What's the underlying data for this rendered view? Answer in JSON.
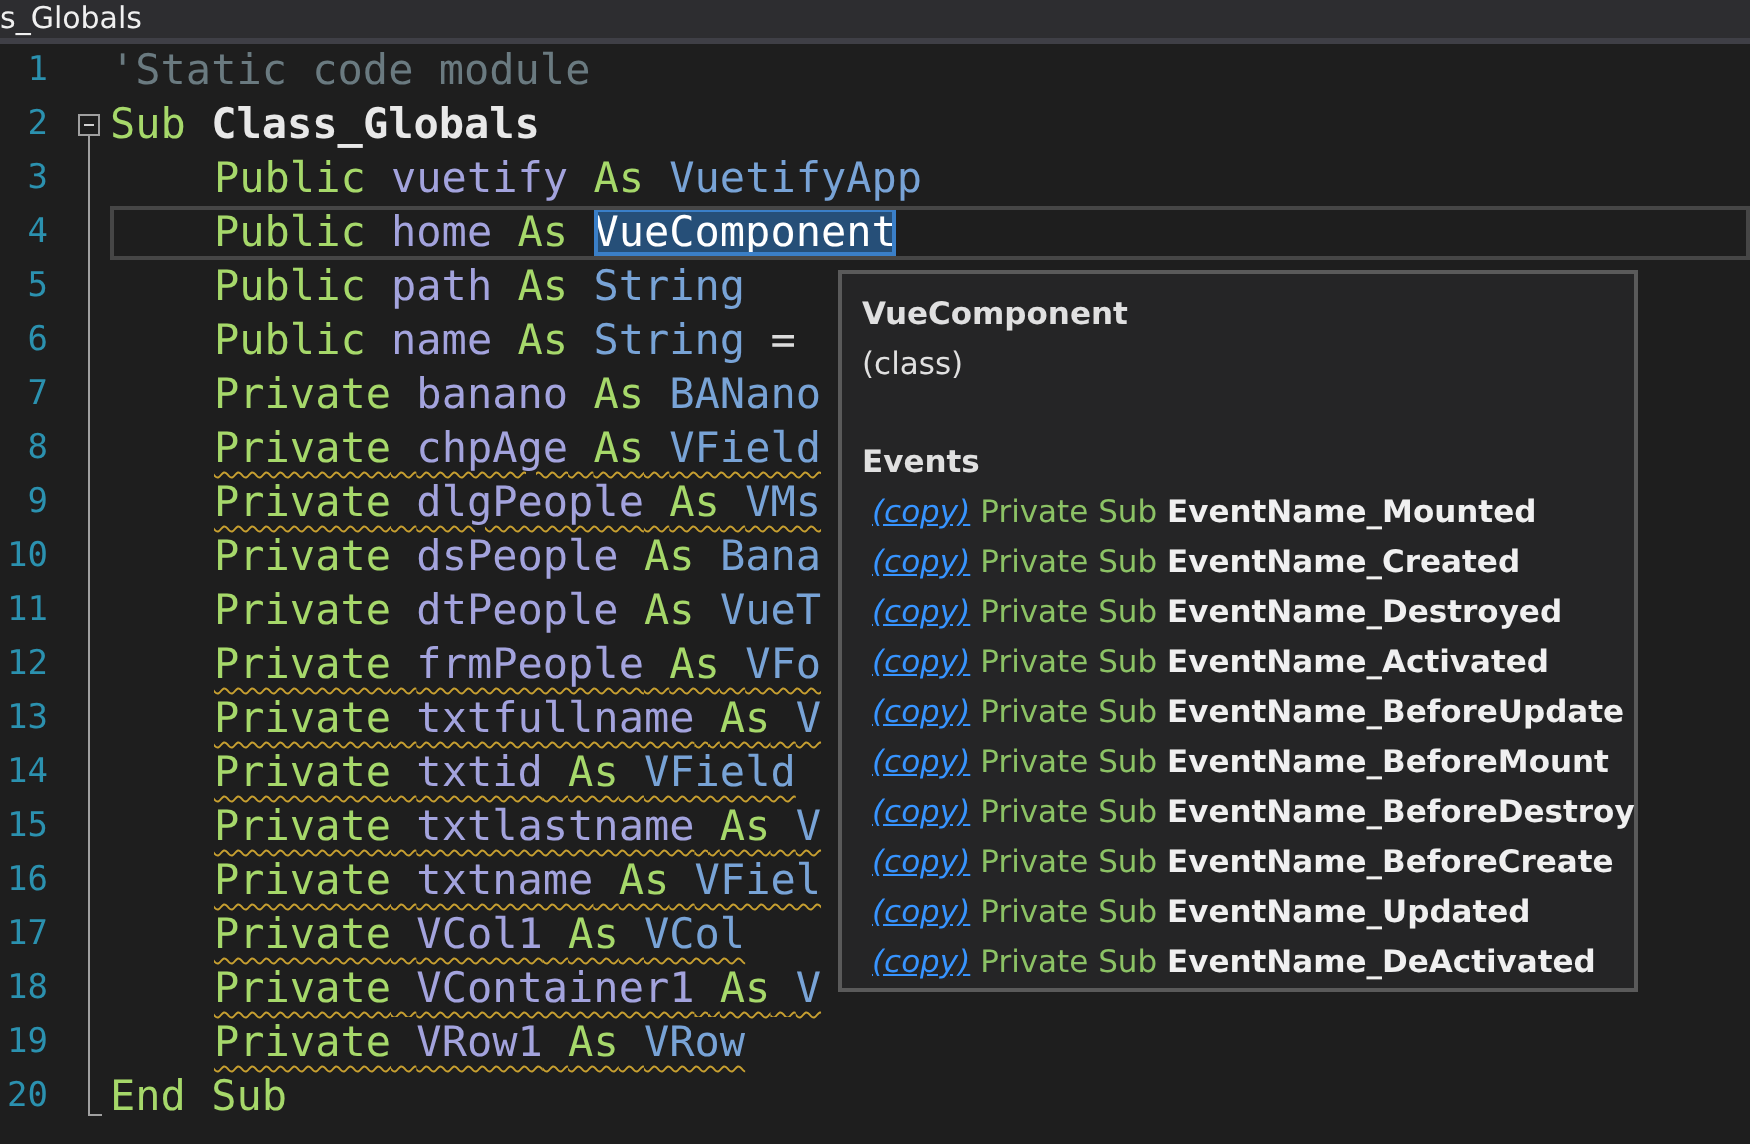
{
  "tab": {
    "title": "s_Globals"
  },
  "lines": [
    {
      "number": "1",
      "current": false,
      "warning": false,
      "tokens": [
        {
          "kind": "comment",
          "text": "'Static code module"
        }
      ]
    },
    {
      "number": "2",
      "current": false,
      "warning": false,
      "expanded": true,
      "tokens": [
        {
          "kind": "keyword",
          "text": "Sub"
        },
        {
          "kind": "name",
          "text": "Class_Globals"
        }
      ],
      "children": [
        {
          "number": "3",
          "current": false,
          "warning": false,
          "tokens": [
            {
              "kind": "keyword",
              "text": "Public"
            },
            {
              "kind": "ident",
              "text": "vuetify"
            },
            {
              "kind": "keyword",
              "text": "As"
            },
            {
              "kind": "type",
              "text": "VuetifyApp"
            }
          ]
        },
        {
          "number": "4",
          "current": true,
          "warning": false,
          "tokens": [
            {
              "kind": "keyword",
              "text": "Public"
            },
            {
              "kind": "ident",
              "text": "home"
            },
            {
              "kind": "keyword",
              "text": "As"
            },
            {
              "kind": "selected",
              "text": "VueComponent"
            }
          ]
        },
        {
          "number": "5",
          "current": false,
          "warning": false,
          "tokens": [
            {
              "kind": "keyword",
              "text": "Public"
            },
            {
              "kind": "ident",
              "text": "path"
            },
            {
              "kind": "keyword",
              "text": "As"
            },
            {
              "kind": "type",
              "text": "String"
            }
          ]
        },
        {
          "number": "6",
          "current": false,
          "warning": false,
          "tokens": [
            {
              "kind": "keyword",
              "text": "Public"
            },
            {
              "kind": "ident",
              "text": "name"
            },
            {
              "kind": "keyword",
              "text": "As"
            },
            {
              "kind": "type",
              "text": "String"
            },
            {
              "kind": "plain",
              "text": "="
            }
          ]
        },
        {
          "number": "7",
          "current": false,
          "warning": false,
          "tokens": [
            {
              "kind": "keyword",
              "text": "Private"
            },
            {
              "kind": "ident",
              "text": "banano"
            },
            {
              "kind": "keyword",
              "text": "As"
            },
            {
              "kind": "type",
              "text": "BANano"
            }
          ]
        },
        {
          "number": "8",
          "current": false,
          "warning": true,
          "tokens": [
            {
              "kind": "keyword",
              "text": "Private"
            },
            {
              "kind": "ident",
              "text": "chpAge"
            },
            {
              "kind": "keyword",
              "text": "As"
            },
            {
              "kind": "type",
              "text": "VField"
            }
          ]
        },
        {
          "number": "9",
          "current": false,
          "warning": true,
          "tokens": [
            {
              "kind": "keyword",
              "text": "Private"
            },
            {
              "kind": "ident",
              "text": "dlgPeople"
            },
            {
              "kind": "keyword",
              "text": "As"
            },
            {
              "kind": "type",
              "text": "VMs"
            }
          ]
        },
        {
          "number": "10",
          "current": false,
          "warning": false,
          "tokens": [
            {
              "kind": "keyword",
              "text": "Private"
            },
            {
              "kind": "ident",
              "text": "dsPeople"
            },
            {
              "kind": "keyword",
              "text": "As"
            },
            {
              "kind": "type",
              "text": "Bana"
            }
          ]
        },
        {
          "number": "11",
          "current": false,
          "warning": false,
          "tokens": [
            {
              "kind": "keyword",
              "text": "Private"
            },
            {
              "kind": "ident",
              "text": "dtPeople"
            },
            {
              "kind": "keyword",
              "text": "As"
            },
            {
              "kind": "type",
              "text": "VueT"
            }
          ]
        },
        {
          "number": "12",
          "current": false,
          "warning": true,
          "tokens": [
            {
              "kind": "keyword",
              "text": "Private"
            },
            {
              "kind": "ident",
              "text": "frmPeople"
            },
            {
              "kind": "keyword",
              "text": "As"
            },
            {
              "kind": "type",
              "text": "VFo"
            }
          ]
        },
        {
          "number": "13",
          "current": false,
          "warning": true,
          "tokens": [
            {
              "kind": "keyword",
              "text": "Private"
            },
            {
              "kind": "ident",
              "text": "txtfullname"
            },
            {
              "kind": "keyword",
              "text": "As"
            },
            {
              "kind": "type",
              "text": "V"
            }
          ]
        },
        {
          "number": "14",
          "current": false,
          "warning": true,
          "tokens": [
            {
              "kind": "keyword",
              "text": "Private"
            },
            {
              "kind": "ident",
              "text": "txtid"
            },
            {
              "kind": "keyword",
              "text": "As"
            },
            {
              "kind": "type",
              "text": "VField"
            }
          ]
        },
        {
          "number": "15",
          "current": false,
          "warning": true,
          "tokens": [
            {
              "kind": "keyword",
              "text": "Private"
            },
            {
              "kind": "ident",
              "text": "txtlastname"
            },
            {
              "kind": "keyword",
              "text": "As"
            },
            {
              "kind": "type",
              "text": "V"
            }
          ]
        },
        {
          "number": "16",
          "current": false,
          "warning": true,
          "tokens": [
            {
              "kind": "keyword",
              "text": "Private"
            },
            {
              "kind": "ident",
              "text": "txtname"
            },
            {
              "kind": "keyword",
              "text": "As"
            },
            {
              "kind": "type",
              "text": "VFiel"
            }
          ]
        },
        {
          "number": "17",
          "current": false,
          "warning": true,
          "tokens": [
            {
              "kind": "keyword",
              "text": "Private"
            },
            {
              "kind": "ident",
              "text": "VCol1"
            },
            {
              "kind": "keyword",
              "text": "As"
            },
            {
              "kind": "type",
              "text": "VCol"
            }
          ]
        },
        {
          "number": "18",
          "current": false,
          "warning": true,
          "tokens": [
            {
              "kind": "keyword",
              "text": "Private"
            },
            {
              "kind": "ident",
              "text": "VContainer1"
            },
            {
              "kind": "keyword",
              "text": "As"
            },
            {
              "kind": "type",
              "text": "V"
            }
          ]
        },
        {
          "number": "19",
          "current": false,
          "warning": true,
          "tokens": [
            {
              "kind": "keyword",
              "text": "Private"
            },
            {
              "kind": "ident",
              "text": "VRow1"
            },
            {
              "kind": "keyword",
              "text": "As"
            },
            {
              "kind": "type",
              "text": "VRow"
            }
          ]
        }
      ]
    },
    {
      "number": "20",
      "current": false,
      "warning": false,
      "tokens": [
        {
          "kind": "keyword",
          "text": "End"
        },
        {
          "kind": "keyword",
          "text": "Sub"
        }
      ]
    }
  ],
  "tooltip": {
    "title": "VueComponent",
    "subtitle": "(class)",
    "section": "Events",
    "events": [
      {
        "link": "(copy)",
        "prefix": "Private Sub",
        "name": "EventName_Mounted"
      },
      {
        "link": "(copy)",
        "prefix": "Private Sub",
        "name": "EventName_Created"
      },
      {
        "link": "(copy)",
        "prefix": "Private Sub",
        "name": "EventName_Destroyed"
      },
      {
        "link": "(copy)",
        "prefix": "Private Sub",
        "name": "EventName_Activated"
      },
      {
        "link": "(copy)",
        "prefix": "Private Sub",
        "name": "EventName_BeforeUpdate"
      },
      {
        "link": "(copy)",
        "prefix": "Private Sub",
        "name": "EventName_BeforeMount"
      },
      {
        "link": "(copy)",
        "prefix": "Private Sub",
        "name": "EventName_BeforeDestroy"
      },
      {
        "link": "(copy)",
        "prefix": "Private Sub",
        "name": "EventName_BeforeCreate"
      },
      {
        "link": "(copy)",
        "prefix": "Private Sub",
        "name": "EventName_Updated"
      },
      {
        "link": "(copy)",
        "prefix": "Private Sub",
        "name": "EventName_DeActivated"
      }
    ]
  }
}
